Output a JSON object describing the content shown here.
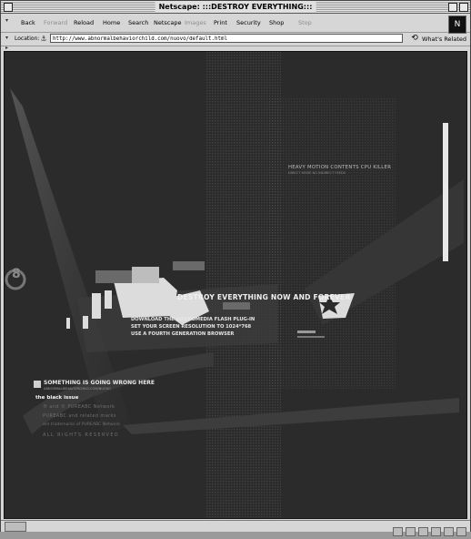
{
  "window": {
    "title": "Netscape: :::DESTROY EVERYTHING:::"
  },
  "toolbar": {
    "buttons": [
      {
        "label": "Back",
        "enabled": true
      },
      {
        "label": "Forward",
        "enabled": false
      },
      {
        "label": "Reload",
        "enabled": true
      },
      {
        "label": "Home",
        "enabled": true
      },
      {
        "label": "Search",
        "enabled": true
      },
      {
        "label": "Netscape",
        "enabled": true
      },
      {
        "label": "Images",
        "enabled": false
      },
      {
        "label": "Print",
        "enabled": true
      },
      {
        "label": "Security",
        "enabled": true
      },
      {
        "label": "Shop",
        "enabled": true
      },
      {
        "label": "Stop",
        "enabled": false
      }
    ]
  },
  "location": {
    "label": "Location:",
    "url": "http://www.abnormalbehaviorchild.com/nuovo/default.html",
    "related_label": "What's Related"
  },
  "page": {
    "cpu_killer": "HEAVY MOTION CONTENTS CPU KILLER",
    "cpu_killer_sub": "DIRECT MODE NO INDIRECT FEEDS",
    "headline": "DESTROY EVERYTHING NOW AND FOREVER",
    "instructions": [
      "DOWNLOAD THE MACROMEDIA FLASH PLUG-IN",
      "SET YOUR SCREEN RESOLUTION TO 1024*768",
      "USE A FOURTH GENERATION BROWSER"
    ],
    "side_number": "8",
    "warning": "SOMETHING IS GOING WRONG HERE",
    "warning_sub": "ABNORMALBEHAVIORCHILD.COM/NUOVO",
    "issue": "the black issue",
    "footer_lines": [
      "® and © PUREABC Network",
      "PUREABC and related marks",
      "are trademarks of PUREABC Network",
      "ALL RIGHTS RESERVED"
    ]
  },
  "icons": {
    "netscape_logo": "netscape-n-logo",
    "location_icon": "page-proxy-icon",
    "related_icon": "whats-related-icon"
  },
  "colors": {
    "chrome": "#d6d6d6",
    "page_background": "#2b2b2b",
    "page_text": "#e6e6e6"
  }
}
